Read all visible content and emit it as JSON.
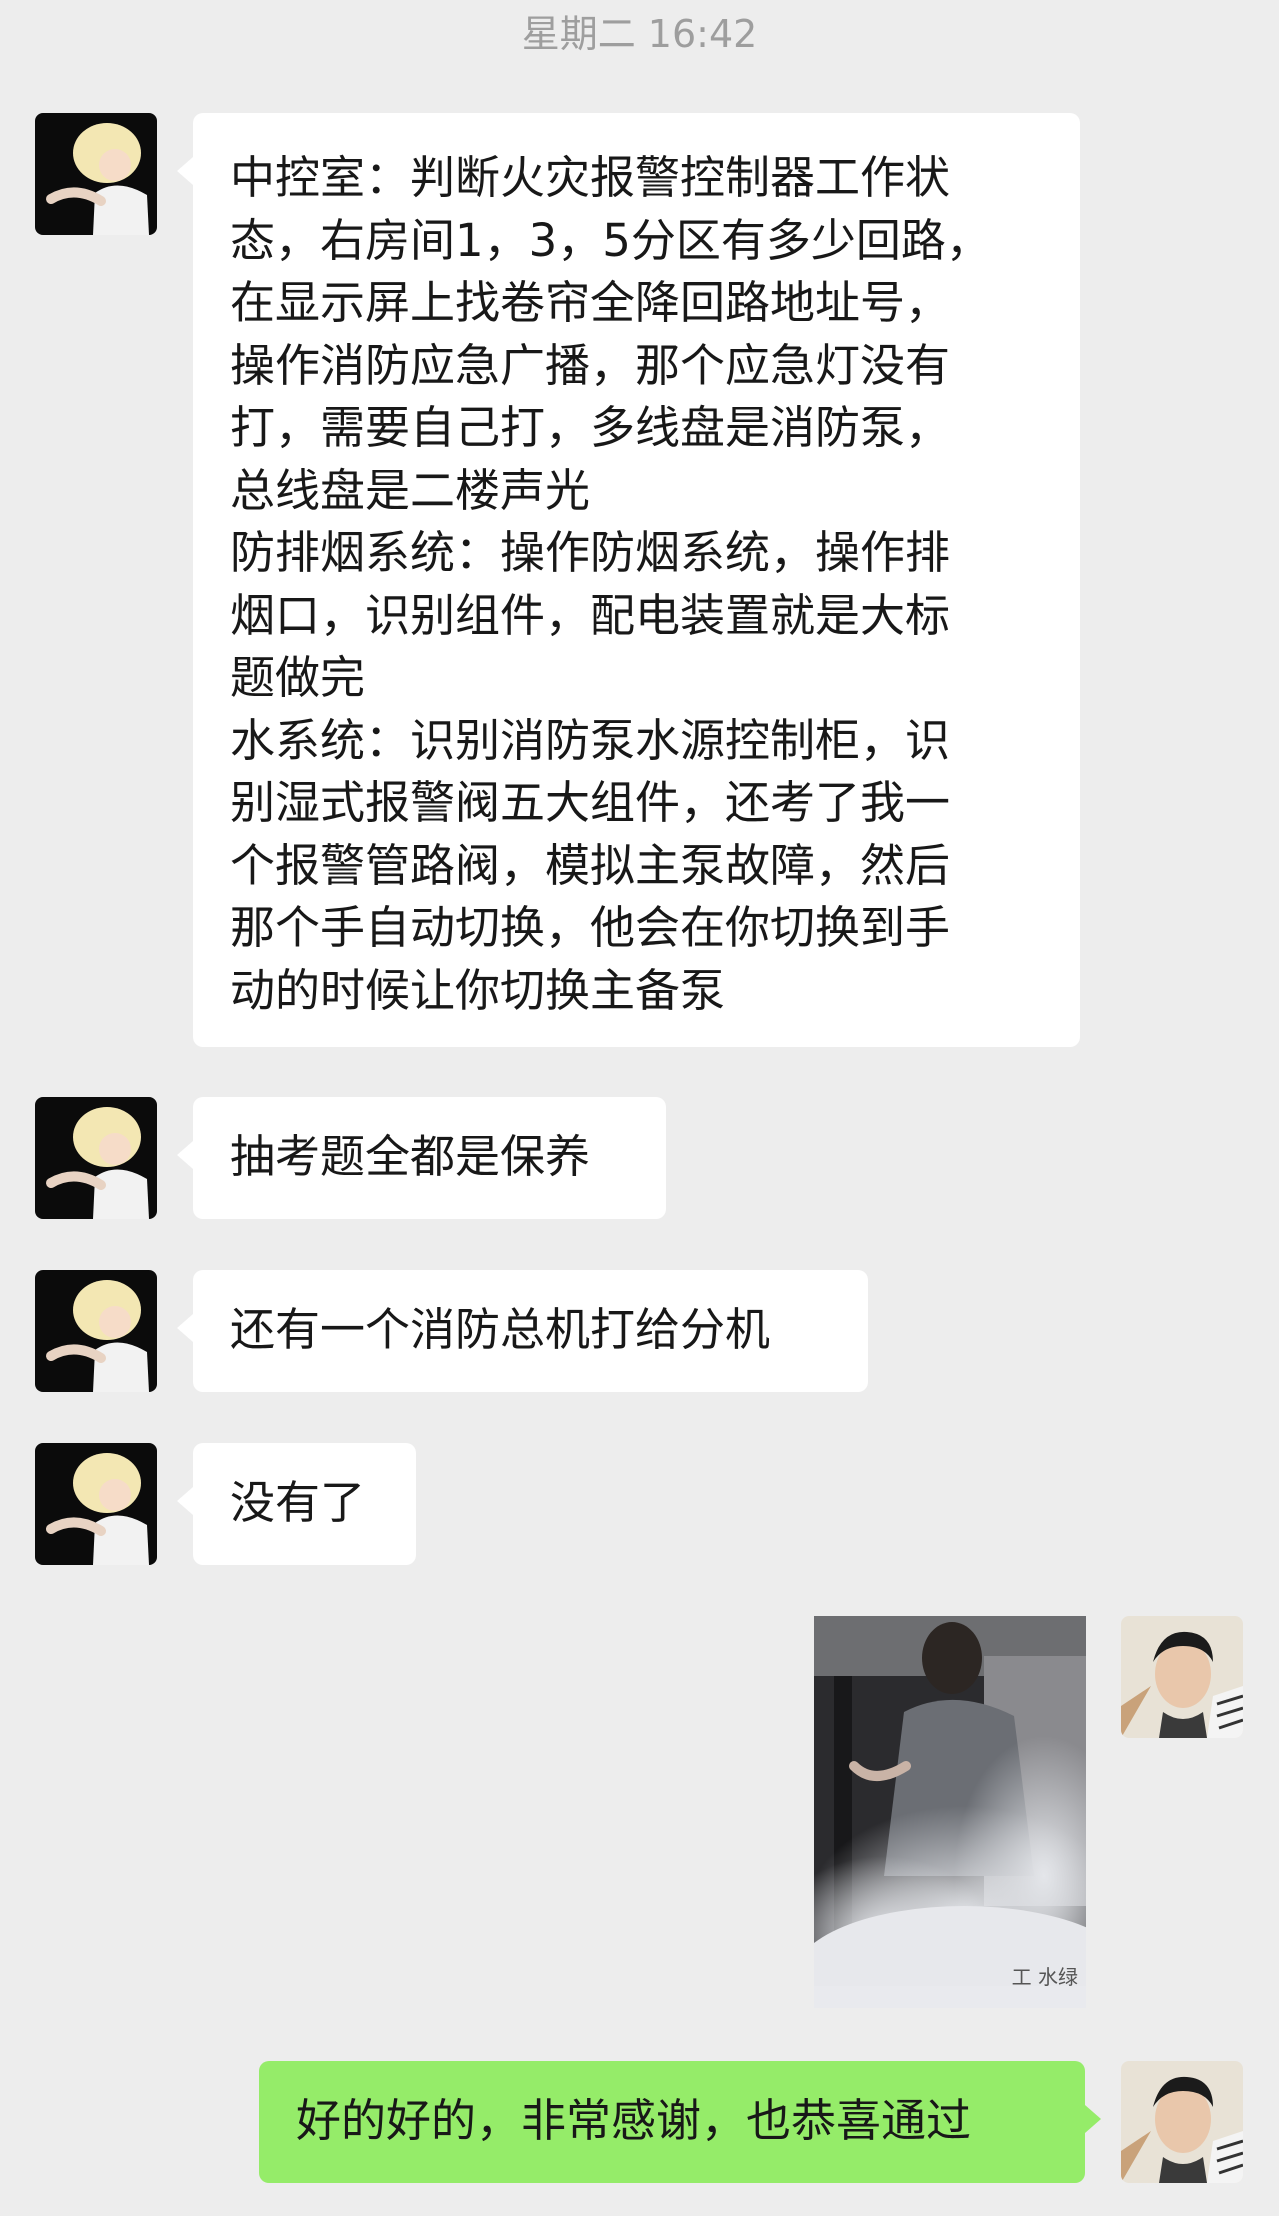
{
  "timestamp": "星期二 16:42",
  "messages": {
    "m1": {
      "lines": [
        "中控室：判断火灾报警控制器工作状",
        "态，右房间1，3，5分区有多少回路，",
        "在显示屏上找卷帘全降回路地址号，",
        "操作消防应急广播，那个应急灯没有",
        "打，需要自己打，多线盘是消防泵，",
        "总线盘是二楼声光",
        "防排烟系统：操作防烟系统，操作排",
        "烟口，识别组件，配电装置就是大标",
        "题做完",
        "水系统：识别消防泵水源控制柜，识",
        "别湿式报警阀五大组件，还考了我一",
        "个报警管路阀，模拟主泵故障，然后",
        "那个手自动切换，他会在你切换到手",
        "动的时候让你切换主备泵"
      ]
    },
    "m2": {
      "text": "抽考题全都是保养"
    },
    "m3": {
      "text": "还有一个消防总机打给分机"
    },
    "m4": {
      "text": "没有了"
    },
    "m6": {
      "text": "好的好的，非常感谢，也恭喜通过"
    }
  },
  "sticker_watermark": "工 水绿",
  "colors": {
    "background": "#EDEDED",
    "incoming_bubble": "#FFFFFF",
    "outgoing_bubble": "#95EC69",
    "timestamp_text": "#9E9E9E"
  }
}
